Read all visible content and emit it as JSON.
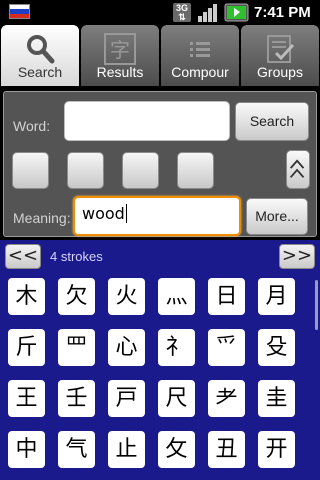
{
  "status_bar": {
    "flag_icon": "russian-flag-icon",
    "network_label": "3G",
    "time": "7:41 PM"
  },
  "tabs": [
    {
      "label": "Search",
      "icon": "magnifier-icon",
      "active": true
    },
    {
      "label": "Results",
      "icon": "kanji-icon",
      "active": false
    },
    {
      "label": "Compour",
      "icon": "list-icon",
      "active": false
    },
    {
      "label": "Groups",
      "icon": "checklist-icon",
      "active": false
    }
  ],
  "search": {
    "word_label": "Word:",
    "word_value": "",
    "search_button": "Search",
    "up_icon": "double-chevron-up-icon",
    "meaning_label": "Meaning:",
    "meaning_value": "wood",
    "more_button": "More..."
  },
  "strokes": {
    "prev_label": "<<",
    "label": "4 strokes",
    "next_label": ">>"
  },
  "radicals": [
    "木",
    "欠",
    "火",
    "灬",
    "日",
    "月",
    "斤",
    "罒",
    "心",
    "礻",
    "爫",
    "殳",
    "王",
    "壬",
    "戸",
    "尺",
    "耂",
    "圭",
    "中",
    "气",
    "止",
    "攵",
    "丑",
    "开"
  ],
  "colors": {
    "accent": "#f08c00",
    "grid_background": "#1a1a8c",
    "panel_background": "#545454"
  }
}
